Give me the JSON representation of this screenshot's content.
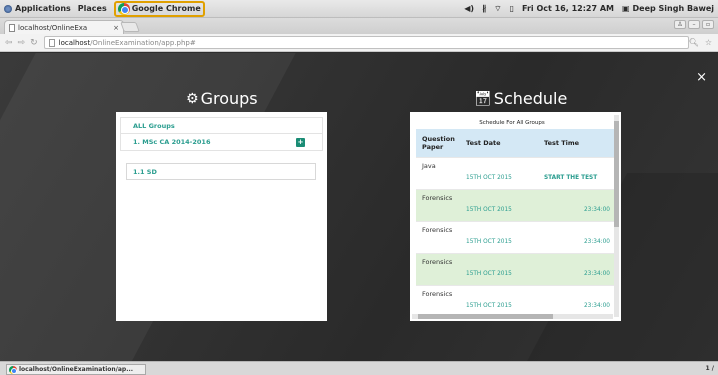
{
  "topbar": {
    "applications": "Applications",
    "places": "Places",
    "app_name": "Google Chrome",
    "volume": "◀)",
    "bluetooth": "∦",
    "wifi": "⌔",
    "battery": "▯",
    "datetime": "Fri Oct 16, 12:27 AM",
    "user": "Deep Singh Bawej"
  },
  "browser": {
    "tab_title": "localhost/OnlineExa",
    "tab_close": "×",
    "url_host": "localhost",
    "url_path": "/OnlineExamination/app.php#"
  },
  "modal": {
    "close": "×",
    "groups_title": "Groups",
    "schedule_title": "Schedule"
  },
  "groups": {
    "items": [
      {
        "label": "ALL Groups"
      },
      {
        "label": "1. MSc CA 2014-2016"
      }
    ],
    "subgroup": "1.1 SD"
  },
  "schedule": {
    "heading": "Schedule For All Groups",
    "columns": [
      "Question Paper",
      "Test Date",
      "Test Time"
    ],
    "rows": [
      {
        "paper": "Java",
        "date": "15TH OCT 2015",
        "time": "START THE TEST"
      },
      {
        "paper": "Forensics",
        "date": "15TH OCT 2015",
        "time": "23:34:00"
      },
      {
        "paper": "Forensics",
        "date": "15TH OCT 2015",
        "time": "23:34:00"
      },
      {
        "paper": "Forensics",
        "date": "15TH OCT 2015",
        "time": "23:34:00"
      },
      {
        "paper": "Forensics",
        "date": "15TH OCT 2015",
        "time": "23:34:00"
      }
    ]
  },
  "statusbar": {
    "task": "localhost/OnlineExamination/ap...",
    "pager": "1 /"
  },
  "colors": {
    "accent": "#2a9d8f",
    "header_bg": "#d4e8f5",
    "row_alt": "#dff0d8"
  }
}
